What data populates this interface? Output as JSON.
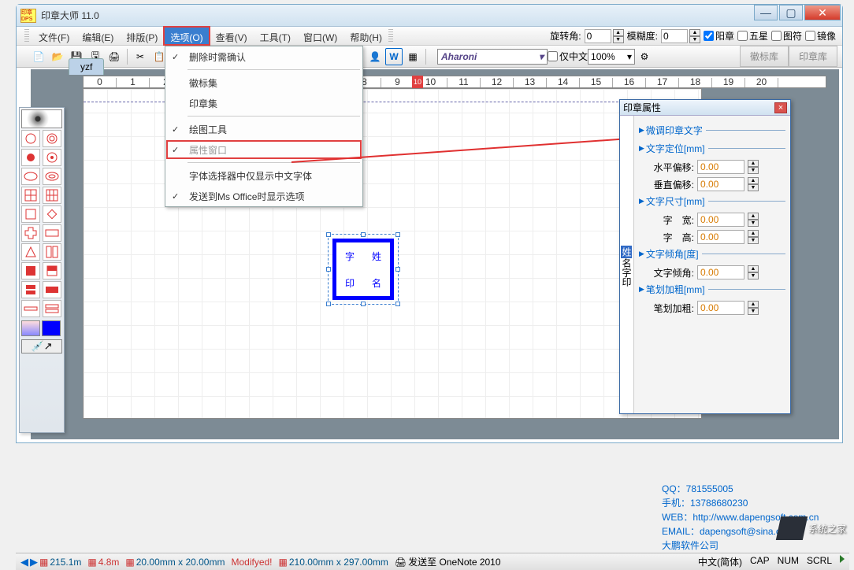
{
  "window": {
    "title": "印章大师 11.0",
    "icon_text": "印章DPS"
  },
  "menu": {
    "items": [
      "文件(F)",
      "编辑(E)",
      "排版(P)",
      "选项(O)",
      "查看(V)",
      "工具(T)",
      "窗口(W)",
      "帮助(H)"
    ],
    "highlighted_index": 3,
    "right": {
      "rotate_label": "旋转角:",
      "rotate_value": "0",
      "blur_label": "模糊度:",
      "blur_value": "0",
      "chk_yang": "阳章",
      "chk_wuxing": "五星",
      "chk_tufu": "图符",
      "chk_mirror": "镜像"
    },
    "dropdown": [
      {
        "label": "删除时需确认",
        "checked": true
      },
      null,
      {
        "label": "徽标集"
      },
      {
        "label": "印章集"
      },
      null,
      {
        "label": "绘图工具",
        "checked": true
      },
      {
        "label": "属性窗口",
        "checked": true,
        "boxed": true
      },
      null,
      {
        "label": "字体选择器中仅显示中文字体"
      },
      {
        "label": "发送到Ms Office时显示选项",
        "checked": true
      }
    ]
  },
  "toolbar": {
    "font": "Aharoni",
    "chinese_only": "仅中文",
    "zoom": "100%",
    "tabs": [
      "徽标库",
      "印章库"
    ]
  },
  "doc": {
    "tab_name": "yzf",
    "ruler_start": 0,
    "ruler_red": "10"
  },
  "stamp": {
    "chars": [
      "字",
      "姓",
      "印",
      "名"
    ]
  },
  "props": {
    "title": "印章属性",
    "side_chars": [
      "姓",
      "名",
      "字",
      "印"
    ],
    "sections": {
      "adjust": "微调印章文字",
      "pos": "文字定位[mm]",
      "pos_h_label": "水平偏移:",
      "pos_h_val": "0.00",
      "pos_v_label": "垂直偏移:",
      "pos_v_val": "0.00",
      "size": "文字尺寸[mm]",
      "size_w_label": "字　宽:",
      "size_w_val": "0.00",
      "size_h_label": "字　高:",
      "size_h_val": "0.00",
      "angle": "文字倾角[度]",
      "angle_label": "文字倾角:",
      "angle_val": "0.00",
      "bold": "笔划加粗[mm]",
      "bold_label": "笔划加粗:",
      "bold_val": "0.00"
    }
  },
  "contact": {
    "qq": "QQ：781555005",
    "phone": "手机：13788680230",
    "web": "WEB：http://www.dapengsoft.com.cn",
    "email": "EMAIL：dapengsoft@sina.com",
    "company": "大鹏软件公司"
  },
  "corner_logo": "系统之家",
  "status": {
    "pos": "215.1m",
    "dist": "4.8m",
    "stamp_size": "20.00mm x 20.00mm",
    "modified": "Modifyed!",
    "page_size": "210.00mm x 297.00mm",
    "send": "发送至 OneNote 2010",
    "ime": "中文(简体)",
    "caps": "CAP",
    "num": "NUM",
    "scrl": "SCRL"
  }
}
